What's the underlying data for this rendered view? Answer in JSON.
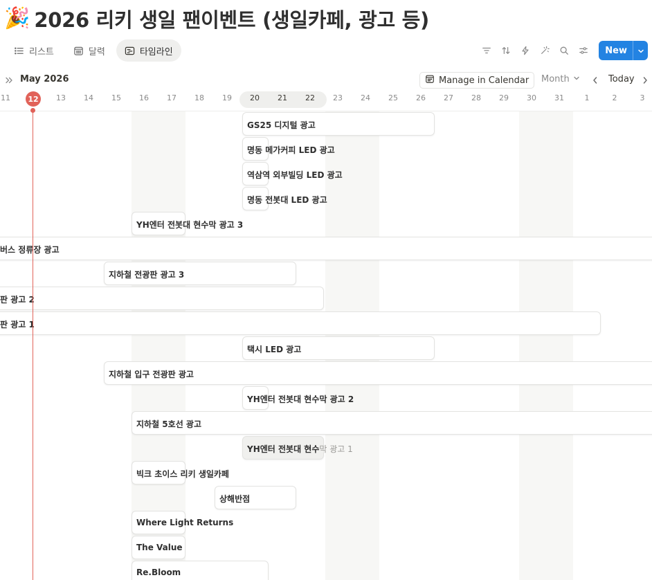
{
  "page": {
    "emoji": "🎉",
    "title": "2026 리키 생일 팬이벤트 (생일카페, 광고 등)"
  },
  "tabs": [
    {
      "label": "리스트",
      "icon": "list-icon",
      "active": false
    },
    {
      "label": "달력",
      "icon": "calendar-icon",
      "active": false
    },
    {
      "label": "타임라인",
      "icon": "timeline-icon",
      "active": true
    }
  ],
  "toolbar": {
    "icons": [
      "filter-icon",
      "sort-icon",
      "lightning-icon",
      "sparkle-icon",
      "search-icon",
      "settings-sliders-icon"
    ],
    "new_label": "New"
  },
  "timeline": {
    "month_label": "May 2026",
    "manage_label": "Manage in Calendar",
    "scale_label": "Month",
    "today_label": "Today",
    "today_day": "12",
    "days": [
      "11",
      "12",
      "13",
      "14",
      "15",
      "16",
      "17",
      "18",
      "19",
      "20",
      "21",
      "22",
      "23",
      "24",
      "25",
      "26",
      "27",
      "28",
      "29",
      "30",
      "31",
      "1",
      "2",
      "3"
    ],
    "current_week_days": [
      "20",
      "21",
      "22"
    ]
  },
  "events": [
    {
      "name": "GS25 디지털 광고"
    },
    {
      "name": "명동 메가커피 LED 광고"
    },
    {
      "name": "역삼역 외부빌딩 LED 광고"
    },
    {
      "name": "명동 전봇대 LED 광고"
    },
    {
      "name": "YH엔터 전봇대 현수막 광고 3"
    },
    {
      "name": "버스 정류장 광고"
    },
    {
      "name": "지하철 전광판 광고 3"
    },
    {
      "name": "판 광고 2"
    },
    {
      "name": "판 광고 1"
    },
    {
      "name": "택시 LED 광고"
    },
    {
      "name": "지하철 입구 전광판 광고"
    },
    {
      "name": "YH엔터 전봇대 현수막 광고 2"
    },
    {
      "name": "지하철 5호선 광고"
    },
    {
      "name": "YH엔터 전봇대 현수막 광고 1",
      "name_visible": "YH엔터 전봇대 현수",
      "name_faded": "막 광고 1"
    },
    {
      "name": "빅크 초이스 리키 생일카페"
    },
    {
      "name": "상해반점"
    },
    {
      "name": "Where Light Returns"
    },
    {
      "name": "The Value"
    },
    {
      "name": "Re.Bloom"
    }
  ]
}
